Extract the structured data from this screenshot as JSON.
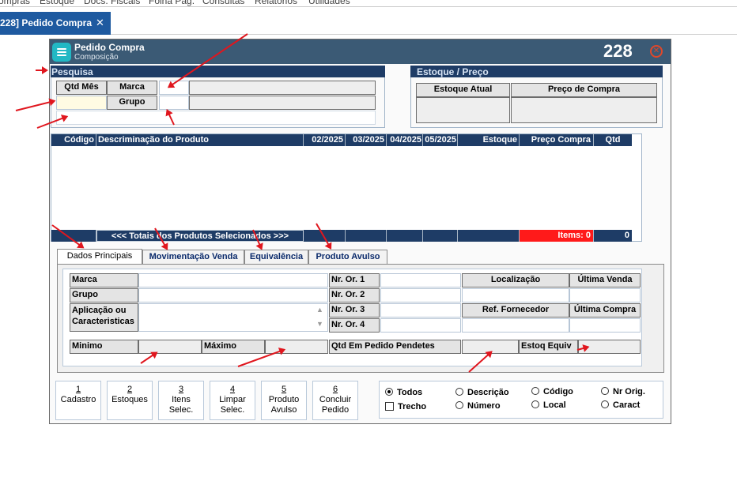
{
  "menubar": [
    "ompras",
    "Estoque",
    "Docs. Fiscais",
    "Folha Pag.",
    "Consultas",
    "Relatórios",
    "Utilidades"
  ],
  "doc_tab": {
    "label": "228] Pedido Compra",
    "close": "✕"
  },
  "window": {
    "title": "Pedido Compra",
    "subtitle": "Composição",
    "number": "228",
    "close": "✕"
  },
  "pesquisa": {
    "title": "Pesquisa",
    "qtd_mes": "Qtd Mês",
    "marca": "Marca",
    "grupo": "Grupo"
  },
  "estoque_preco": {
    "title": "Estoque / Preço",
    "estoque_atual": "Estoque Atual",
    "preco_compra": "Preço de Compra"
  },
  "grid": {
    "columns": [
      "Código",
      "Descriminação do Produto",
      "02/2025",
      "03/2025",
      "04/2025",
      "05/2025",
      "Estoque",
      "Preço Compra",
      "Qtd"
    ],
    "totals_label": "<<< Totais dos Produtos Selecionados >>>",
    "items_label": "Items: 0",
    "qtd_total": "0"
  },
  "tabs": [
    "Dados Principais",
    "Movimentação Venda",
    "Equivalência",
    "Produto Avulso"
  ],
  "dados": {
    "marca": "Marca",
    "grupo": "Grupo",
    "aplicacao": "Aplicação ou",
    "caracteristicas": "Caracteristicas",
    "nr_or_1": "Nr. Or. 1",
    "nr_or_2": "Nr. Or. 2",
    "nr_or_3": "Nr. Or. 3",
    "nr_or_4": "Nr. Or. 4",
    "localizacao": "Localização",
    "ultima_venda": "Última Venda",
    "ref_fornecedor": "Ref. Fornecedor",
    "ultima_compra": "Última Compra",
    "minimo": "Minimo",
    "maximo": "Máximo",
    "qtd_pedido": "Qtd Em Pedido Pendetes",
    "estoq_equiv": "Estoq Equiv"
  },
  "buttons": [
    {
      "num": "1",
      "label": "Cadastro"
    },
    {
      "num": "2",
      "label": "Estoques"
    },
    {
      "num": "3",
      "label": "Itens Selec."
    },
    {
      "num": "4",
      "label": "Limpar Selec."
    },
    {
      "num": "5",
      "label": "Produto Avulso"
    },
    {
      "num": "6",
      "label": "Concluir Pedido"
    }
  ],
  "filters": {
    "todos": "Todos",
    "trecho": "Trecho",
    "descricao": "Descrição",
    "numero": "Número",
    "codigo": "Código",
    "local": "Local",
    "nr_orig": "Nr Orig.",
    "caract": "Caract",
    "selected": "Todos"
  },
  "colors": {
    "title_bar": "#3b5a75",
    "grid_header": "#1e3c66",
    "items_red": "#ff1a1a",
    "arrow": "#e0161e",
    "accent_blue": "#0a2a6b"
  }
}
